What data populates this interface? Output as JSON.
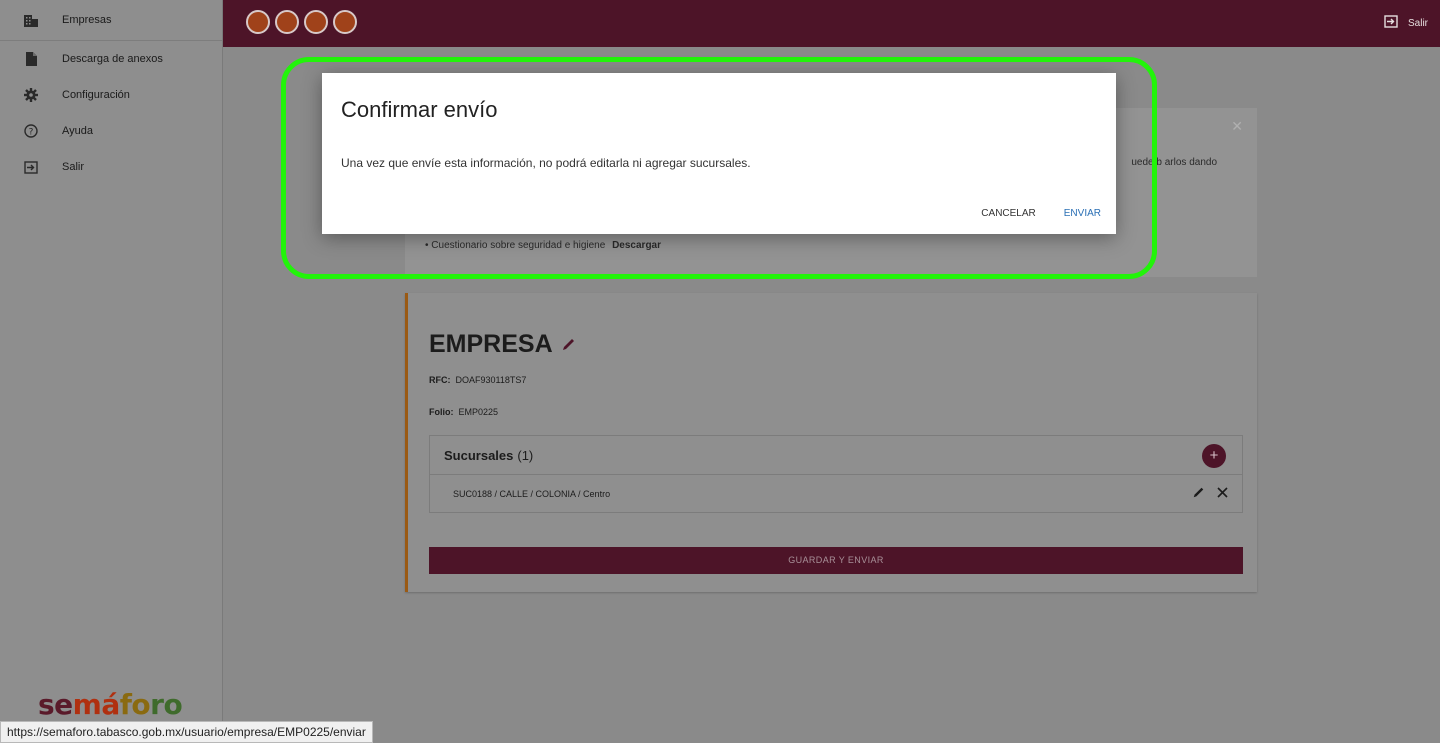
{
  "sidebar": {
    "items": [
      {
        "label": "Empresas",
        "icon": "building-icon"
      },
      {
        "label": "Descarga de anexos",
        "icon": "file-icon"
      },
      {
        "label": "Configuración",
        "icon": "gear-icon"
      },
      {
        "label": "Ayuda",
        "icon": "help-icon"
      },
      {
        "label": "Salir",
        "icon": "exit-icon"
      }
    ],
    "logo": {
      "p1": "se",
      "p2": "má",
      "p3": "fo",
      "p4": "ro"
    }
  },
  "topbar": {
    "logout_label": "Salir",
    "brand_dot_color": "#a0421a",
    "bar_color": "#4d1428"
  },
  "notice": {
    "partial_text": "uede b  arlos dando",
    "bullet_text": "Cuestionario sobre seguridad e higiene",
    "bullet_link": "Descargar"
  },
  "empresa": {
    "title": "EMPRESA",
    "rfc_label": "RFC:",
    "rfc_value": "DOAF930118TS7",
    "folio_label": "Folio:",
    "folio_value": "EMP0225",
    "sucursales_label": "Sucursales",
    "sucursales_count": "(1)",
    "sucursal_row": "SUC0188 / CALLE / COLONIA / Centro",
    "save_label": "GUARDAR Y ENVIAR"
  },
  "dialog": {
    "title": "Confirmar envío",
    "body": "Una vez que envíe esta información, no podrá editarla ni agregar sucursales.",
    "cancel_label": "CANCELAR",
    "send_label": "ENVIAR",
    "send_color": "#2a6fb5"
  },
  "status_bar": {
    "url": "https://semaforo.tabasco.gob.mx/usuario/empresa/EMP0225/enviar"
  },
  "highlight_color": "#22f40a"
}
